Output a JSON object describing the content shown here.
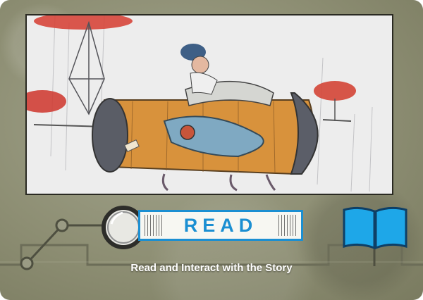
{
  "card": {
    "read_label": "READ",
    "tagline": "Read and Interact with the Story"
  },
  "icons": {
    "magnifier": "magnifier-icon",
    "book": "open-book-icon"
  },
  "colors": {
    "accent": "#1b8fd2",
    "card_bg": "#8e8f74",
    "text": "#ffffff"
  }
}
